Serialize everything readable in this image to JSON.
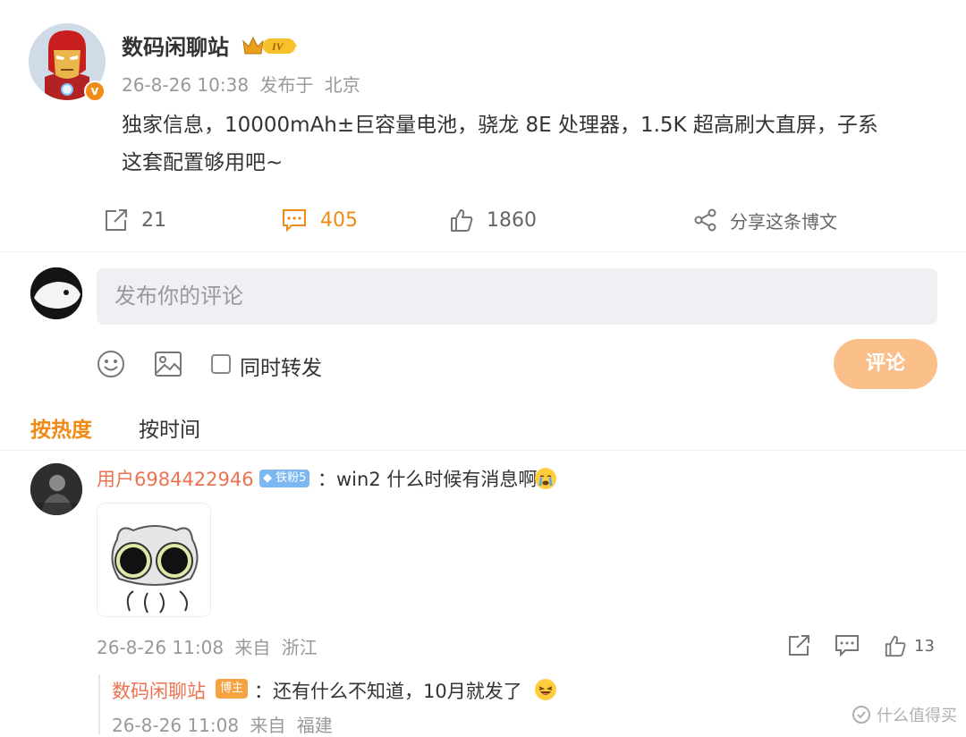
{
  "post": {
    "author": "数码闲聊站",
    "level": "IV",
    "verified_mark": "v",
    "date": "26-8-26 10:38",
    "published_at": "发布于",
    "location": "北京",
    "text": "独家信息，10000mAh±巨容量电池，骁龙 8E 处理器，1.5K 超高刷大直屏，子系\n这套配置够用吧~"
  },
  "actions": {
    "repost_count": "21",
    "comment_count": "405",
    "like_count": "1860",
    "share_label": "分享这条博文"
  },
  "composer": {
    "placeholder": "发布你的评论",
    "repost_label": "同时转发",
    "submit_label": "评论"
  },
  "sort": {
    "hot": "按热度",
    "time": "按时间"
  },
  "comments": [
    {
      "user": "用户6984422946",
      "badge": "铁粉5",
      "text": "：win2 什么时候有消息啊",
      "emoji": "crying-face",
      "date": "26-8-26 11:08",
      "from": "来自",
      "location": "浙江",
      "like_count": "13",
      "replies": [
        {
          "user": "数码闲聊站",
          "badge": "博主",
          "text": "：还有什么不知道，10月就发了",
          "emoji": "laughing-face",
          "date": "26-8-26 11:08",
          "from": "来自",
          "location": "福建"
        }
      ]
    }
  ],
  "watermark": {
    "text": "什么值得买"
  },
  "colors": {
    "accent": "#f08a16",
    "username": "#eb7350",
    "submit_bg": "#fbc08a",
    "composer_bg": "#eef0f4"
  }
}
